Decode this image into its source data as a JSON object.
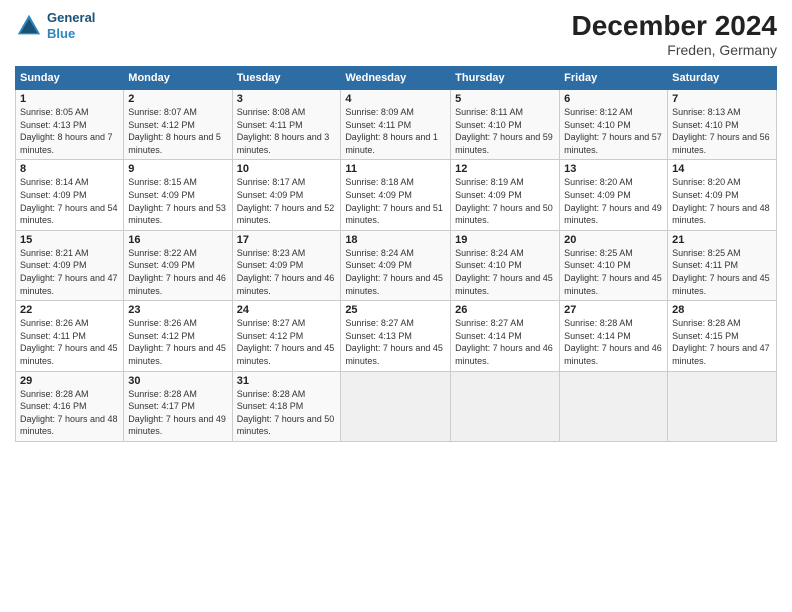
{
  "header": {
    "logo_line1": "General",
    "logo_line2": "Blue",
    "main_title": "December 2024",
    "subtitle": "Freden, Germany"
  },
  "calendar": {
    "headers": [
      "Sunday",
      "Monday",
      "Tuesday",
      "Wednesday",
      "Thursday",
      "Friday",
      "Saturday"
    ],
    "weeks": [
      [
        {
          "day": "",
          "empty": true
        },
        {
          "day": "",
          "empty": true
        },
        {
          "day": "",
          "empty": true
        },
        {
          "day": "",
          "empty": true
        },
        {
          "day": "",
          "empty": true
        },
        {
          "day": "",
          "empty": true
        },
        {
          "day": "",
          "empty": true
        }
      ],
      [
        {
          "day": "1",
          "sunrise": "Sunrise: 8:05 AM",
          "sunset": "Sunset: 4:13 PM",
          "daylight": "Daylight: 8 hours and 7 minutes."
        },
        {
          "day": "2",
          "sunrise": "Sunrise: 8:07 AM",
          "sunset": "Sunset: 4:12 PM",
          "daylight": "Daylight: 8 hours and 5 minutes."
        },
        {
          "day": "3",
          "sunrise": "Sunrise: 8:08 AM",
          "sunset": "Sunset: 4:11 PM",
          "daylight": "Daylight: 8 hours and 3 minutes."
        },
        {
          "day": "4",
          "sunrise": "Sunrise: 8:09 AM",
          "sunset": "Sunset: 4:11 PM",
          "daylight": "Daylight: 8 hours and 1 minute."
        },
        {
          "day": "5",
          "sunrise": "Sunrise: 8:11 AM",
          "sunset": "Sunset: 4:10 PM",
          "daylight": "Daylight: 7 hours and 59 minutes."
        },
        {
          "day": "6",
          "sunrise": "Sunrise: 8:12 AM",
          "sunset": "Sunset: 4:10 PM",
          "daylight": "Daylight: 7 hours and 57 minutes."
        },
        {
          "day": "7",
          "sunrise": "Sunrise: 8:13 AM",
          "sunset": "Sunset: 4:10 PM",
          "daylight": "Daylight: 7 hours and 56 minutes."
        }
      ],
      [
        {
          "day": "8",
          "sunrise": "Sunrise: 8:14 AM",
          "sunset": "Sunset: 4:09 PM",
          "daylight": "Daylight: 7 hours and 54 minutes."
        },
        {
          "day": "9",
          "sunrise": "Sunrise: 8:15 AM",
          "sunset": "Sunset: 4:09 PM",
          "daylight": "Daylight: 7 hours and 53 minutes."
        },
        {
          "day": "10",
          "sunrise": "Sunrise: 8:17 AM",
          "sunset": "Sunset: 4:09 PM",
          "daylight": "Daylight: 7 hours and 52 minutes."
        },
        {
          "day": "11",
          "sunrise": "Sunrise: 8:18 AM",
          "sunset": "Sunset: 4:09 PM",
          "daylight": "Daylight: 7 hours and 51 minutes."
        },
        {
          "day": "12",
          "sunrise": "Sunrise: 8:19 AM",
          "sunset": "Sunset: 4:09 PM",
          "daylight": "Daylight: 7 hours and 50 minutes."
        },
        {
          "day": "13",
          "sunrise": "Sunrise: 8:20 AM",
          "sunset": "Sunset: 4:09 PM",
          "daylight": "Daylight: 7 hours and 49 minutes."
        },
        {
          "day": "14",
          "sunrise": "Sunrise: 8:20 AM",
          "sunset": "Sunset: 4:09 PM",
          "daylight": "Daylight: 7 hours and 48 minutes."
        }
      ],
      [
        {
          "day": "15",
          "sunrise": "Sunrise: 8:21 AM",
          "sunset": "Sunset: 4:09 PM",
          "daylight": "Daylight: 7 hours and 47 minutes."
        },
        {
          "day": "16",
          "sunrise": "Sunrise: 8:22 AM",
          "sunset": "Sunset: 4:09 PM",
          "daylight": "Daylight: 7 hours and 46 minutes."
        },
        {
          "day": "17",
          "sunrise": "Sunrise: 8:23 AM",
          "sunset": "Sunset: 4:09 PM",
          "daylight": "Daylight: 7 hours and 46 minutes."
        },
        {
          "day": "18",
          "sunrise": "Sunrise: 8:24 AM",
          "sunset": "Sunset: 4:09 PM",
          "daylight": "Daylight: 7 hours and 45 minutes."
        },
        {
          "day": "19",
          "sunrise": "Sunrise: 8:24 AM",
          "sunset": "Sunset: 4:10 PM",
          "daylight": "Daylight: 7 hours and 45 minutes."
        },
        {
          "day": "20",
          "sunrise": "Sunrise: 8:25 AM",
          "sunset": "Sunset: 4:10 PM",
          "daylight": "Daylight: 7 hours and 45 minutes."
        },
        {
          "day": "21",
          "sunrise": "Sunrise: 8:25 AM",
          "sunset": "Sunset: 4:11 PM",
          "daylight": "Daylight: 7 hours and 45 minutes."
        }
      ],
      [
        {
          "day": "22",
          "sunrise": "Sunrise: 8:26 AM",
          "sunset": "Sunset: 4:11 PM",
          "daylight": "Daylight: 7 hours and 45 minutes."
        },
        {
          "day": "23",
          "sunrise": "Sunrise: 8:26 AM",
          "sunset": "Sunset: 4:12 PM",
          "daylight": "Daylight: 7 hours and 45 minutes."
        },
        {
          "day": "24",
          "sunrise": "Sunrise: 8:27 AM",
          "sunset": "Sunset: 4:12 PM",
          "daylight": "Daylight: 7 hours and 45 minutes."
        },
        {
          "day": "25",
          "sunrise": "Sunrise: 8:27 AM",
          "sunset": "Sunset: 4:13 PM",
          "daylight": "Daylight: 7 hours and 45 minutes."
        },
        {
          "day": "26",
          "sunrise": "Sunrise: 8:27 AM",
          "sunset": "Sunset: 4:14 PM",
          "daylight": "Daylight: 7 hours and 46 minutes."
        },
        {
          "day": "27",
          "sunrise": "Sunrise: 8:28 AM",
          "sunset": "Sunset: 4:14 PM",
          "daylight": "Daylight: 7 hours and 46 minutes."
        },
        {
          "day": "28",
          "sunrise": "Sunrise: 8:28 AM",
          "sunset": "Sunset: 4:15 PM",
          "daylight": "Daylight: 7 hours and 47 minutes."
        }
      ],
      [
        {
          "day": "29",
          "sunrise": "Sunrise: 8:28 AM",
          "sunset": "Sunset: 4:16 PM",
          "daylight": "Daylight: 7 hours and 48 minutes."
        },
        {
          "day": "30",
          "sunrise": "Sunrise: 8:28 AM",
          "sunset": "Sunset: 4:17 PM",
          "daylight": "Daylight: 7 hours and 49 minutes."
        },
        {
          "day": "31",
          "sunrise": "Sunrise: 8:28 AM",
          "sunset": "Sunset: 4:18 PM",
          "daylight": "Daylight: 7 hours and 50 minutes."
        },
        {
          "day": "",
          "empty": true
        },
        {
          "day": "",
          "empty": true
        },
        {
          "day": "",
          "empty": true
        },
        {
          "day": "",
          "empty": true
        }
      ]
    ]
  }
}
